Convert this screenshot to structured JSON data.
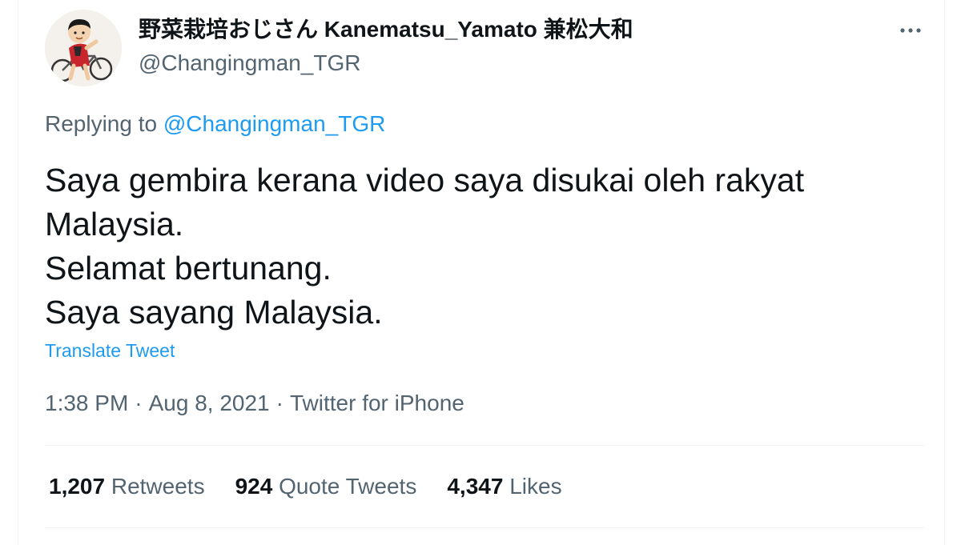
{
  "author": {
    "display_name": "野菜栽培おじさん Kanematsu_Yamato 兼松大和",
    "handle": "@Changingman_TGR",
    "avatar_icon": "cyclist-avatar"
  },
  "more_icon": "more-options-icon",
  "reply": {
    "prefix": "Replying to",
    "mention": "@Changingman_TGR"
  },
  "tweet_lines": [
    "Saya gembira kerana video saya disukai oleh rakyat",
    "Malaysia.",
    "Selamat bertunang.",
    "Saya sayang Malaysia."
  ],
  "translate_label": "Translate Tweet",
  "meta": {
    "time": "1:38 PM",
    "separator": "·",
    "date": "Aug 8, 2021",
    "source": "Twitter for iPhone"
  },
  "stats": [
    {
      "count": "1,207",
      "label": "Retweets"
    },
    {
      "count": "924",
      "label": "Quote Tweets"
    },
    {
      "count": "4,347",
      "label": "Likes"
    }
  ],
  "colors": {
    "accent": "#1d9bf0",
    "text": "#0f1419",
    "secondary": "#536471",
    "border": "#eff3f4"
  }
}
